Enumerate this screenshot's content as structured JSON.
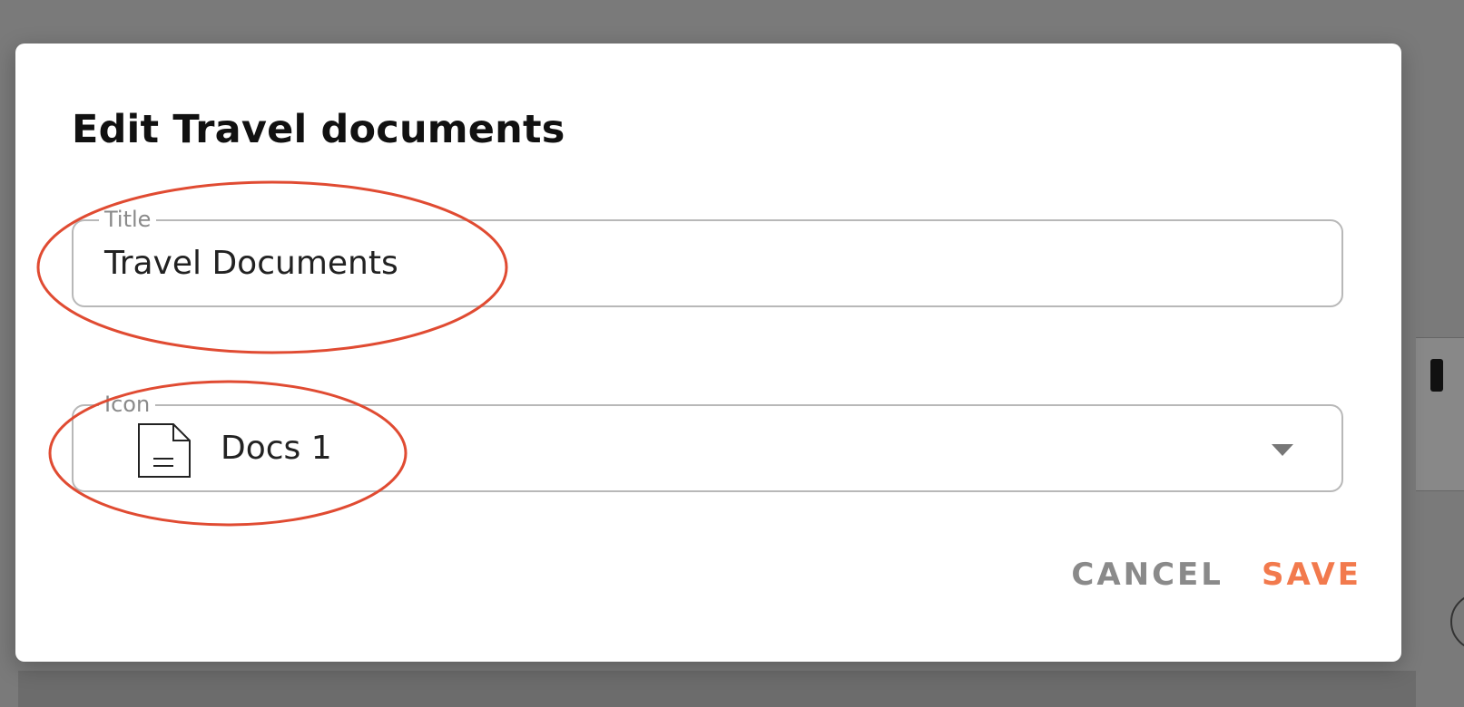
{
  "dialog": {
    "title": "Edit Travel documents",
    "title_field": {
      "label": "Title",
      "value": "Travel Documents"
    },
    "icon_field": {
      "label": "Icon",
      "value": "Docs 1",
      "icon": "document-icon"
    },
    "actions": {
      "cancel_label": "CANCEL",
      "save_label": "SAVE"
    }
  },
  "colors": {
    "accent": "#f27a4d",
    "annotation": "#e04b32",
    "overlay": "#7a7a7a"
  }
}
